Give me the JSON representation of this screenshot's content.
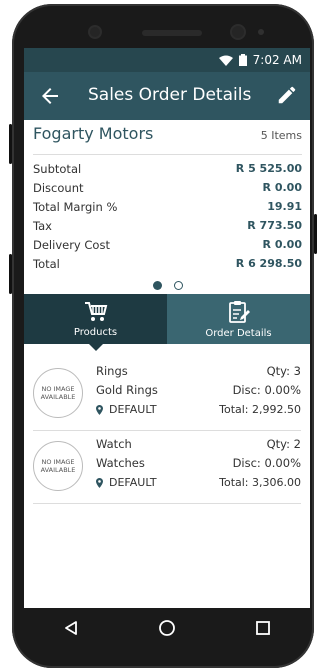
{
  "status_bar": {
    "time": "7:02 AM"
  },
  "app_bar": {
    "title": "Sales Order Details"
  },
  "order": {
    "customer": "Fogarty Motors",
    "items_count": "5 Items",
    "lines": [
      {
        "label": "Subtotal",
        "value": "R 5 525.00"
      },
      {
        "label": "Discount",
        "value": "R 0.00"
      },
      {
        "label": "Total Margin %",
        "value": "19.91"
      },
      {
        "label": "Tax",
        "value": "R 773.50"
      },
      {
        "label": "Delivery Cost",
        "value": "R 0.00"
      },
      {
        "label": "Total",
        "value": "R 6 298.50"
      }
    ]
  },
  "tabs": [
    {
      "label": "Products",
      "icon": "cart-icon",
      "active": true
    },
    {
      "label": "Order Details",
      "icon": "clipboard-edit-icon",
      "active": false
    }
  ],
  "products": [
    {
      "thumb": "NO IMAGE AVAILABLE",
      "name": "Rings",
      "category": "Gold Rings",
      "location": "DEFAULT",
      "qty": "Qty: 3",
      "disc": "Disc: 0.00%",
      "total": "Total: 2,992.50"
    },
    {
      "thumb": "NO IMAGE AVAILABLE",
      "name": "Watch",
      "category": "Watches",
      "location": "DEFAULT",
      "qty": "Qty: 2",
      "disc": "Disc: 0.00%",
      "total": "Total: 3,306.00"
    }
  ],
  "colors": {
    "primary": "#2f5560",
    "primary_dark": "#1e3a42",
    "status_bar": "#27474f"
  }
}
